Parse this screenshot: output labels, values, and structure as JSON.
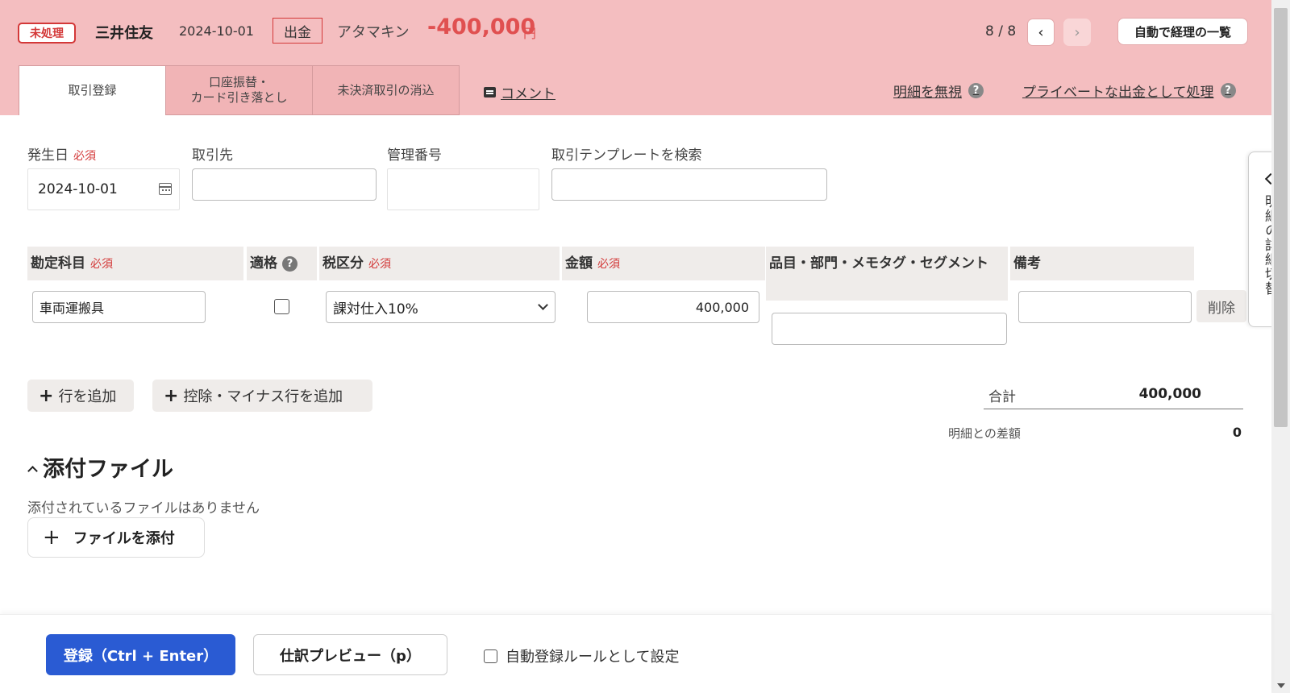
{
  "header": {
    "status_badge": "未処理",
    "bank": "三井住友",
    "date": "2024-10-01",
    "direction": "出金",
    "payee": "アタマキン",
    "amount": "-400,000",
    "currency": "円",
    "pager": "8 / 8",
    "prev_icon": "‹",
    "next_icon": "›",
    "auto_list_button": "自動で経理の一覧",
    "tabs": [
      {
        "label": "取引登録",
        "active": true
      },
      {
        "label": "口座振替・\nカード引き落とし",
        "active": false
      },
      {
        "label": "未決済取引の消込",
        "active": false
      }
    ],
    "comment_link": "コメント",
    "ignore_link": "明細を無視",
    "private_link": "プライベートな出金として処理",
    "help_glyph": "?",
    "colors": {
      "header_bg": "#f4bec0",
      "accent_red": "#e05050",
      "primary_blue": "#2a5bd3"
    }
  },
  "form": {
    "required": "必須",
    "date_label": "発生日",
    "date_value": "2024-10-01",
    "partner_label": "取引先",
    "partner_value": "",
    "control_no_label": "管理番号",
    "control_no_value": "",
    "template_label": "取引テンプレートを検索",
    "template_value": ""
  },
  "table": {
    "headers": {
      "account": "勘定科目",
      "qualified": "適格",
      "tax": "税区分",
      "amount": "金額",
      "tags": "品目・部門・メモタグ・セグメント",
      "note": "備考"
    },
    "row": {
      "account": "車両運搬具",
      "qualified_checked": false,
      "tax": "課対仕入10%",
      "amount": "400,000",
      "tags": "",
      "note": "",
      "delete_label": "削除"
    }
  },
  "actions": {
    "add_row": "行を追加",
    "add_minus_row": "控除・マイナス行を追加"
  },
  "totals": {
    "total_label": "合計",
    "total_value": "400,000",
    "diff_label": "明細との差額",
    "diff_value": "0"
  },
  "attachments": {
    "title": "添付ファイル",
    "empty_text": "添付されているファイルはありません",
    "attach_button": "ファイルを添付"
  },
  "drawer": {
    "label": "明細の詳細切替"
  },
  "footer": {
    "submit_button": "登録（Ctrl + Enter）",
    "preview_button": "仕訳プレビュー（p）",
    "auto_rule_label": "自動登録ルールとして設定"
  }
}
